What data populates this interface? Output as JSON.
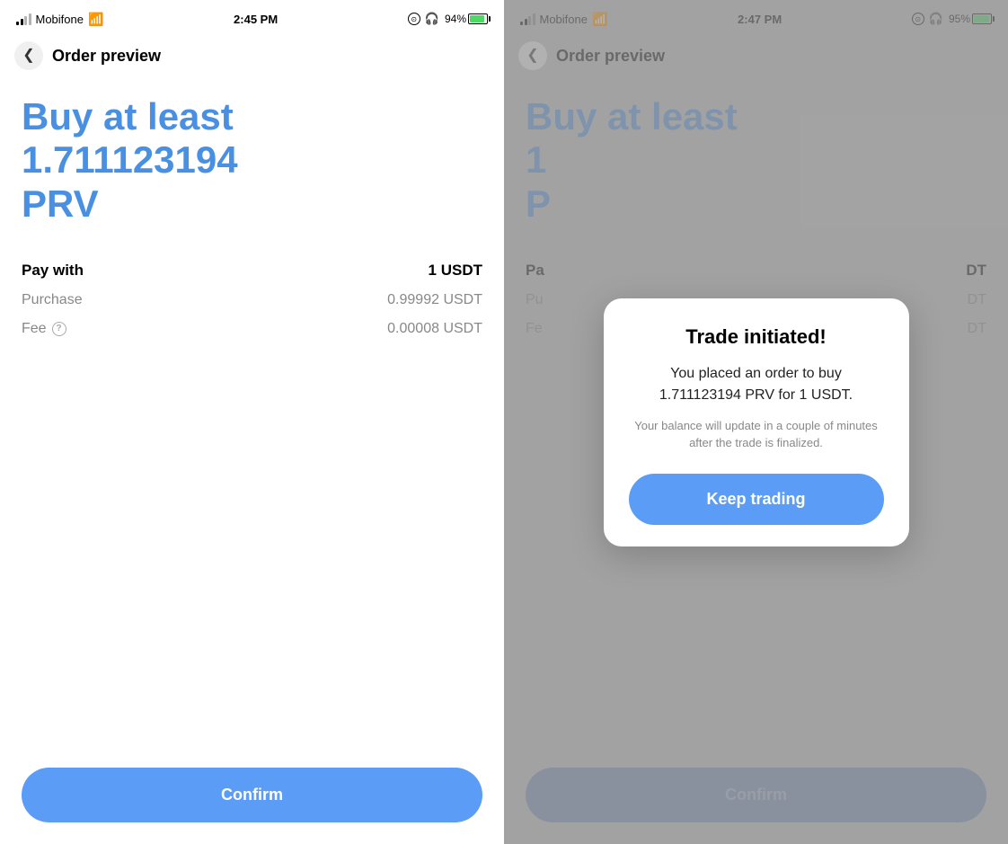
{
  "left_panel": {
    "status_bar": {
      "carrier": "Mobifone",
      "time": "2:45 PM",
      "battery_pct": "94%"
    },
    "header": {
      "back_label": "<",
      "title": "Order preview"
    },
    "buy_heading_line1": "Buy at least",
    "buy_heading_line2": "1.711123194",
    "buy_heading_line3": "PRV",
    "details": [
      {
        "label": "Pay with",
        "value": "1 USDT",
        "bold": true
      },
      {
        "label": "Purchase",
        "value": "0.99992 USDT",
        "bold": false
      },
      {
        "label": "Fee",
        "value": "0.00008 USDT",
        "bold": false,
        "has_info": true
      }
    ],
    "confirm_button": "Confirm"
  },
  "right_panel": {
    "status_bar": {
      "carrier": "Mobifone",
      "time": "2:47 PM",
      "battery_pct": "95%"
    },
    "header": {
      "back_label": "<",
      "title": "Order preview"
    },
    "buy_heading_line1": "Buy at least",
    "buy_heading_line2": "1",
    "buy_heading_line3": "P",
    "details": [
      {
        "label": "Pa",
        "value": "DT",
        "bold": true
      },
      {
        "label": "Pu",
        "value": "DT",
        "bold": false
      },
      {
        "label": "Fe",
        "value": "DT",
        "bold": false,
        "has_info": false
      }
    ],
    "confirm_button": "Confirm",
    "modal": {
      "title": "Trade initiated!",
      "body": "You placed an order to buy 1.711123194 PRV for 1 USDT.",
      "note": "Your balance will update in a couple of minutes after the trade is finalized.",
      "keep_trading": "Keep trading"
    }
  }
}
